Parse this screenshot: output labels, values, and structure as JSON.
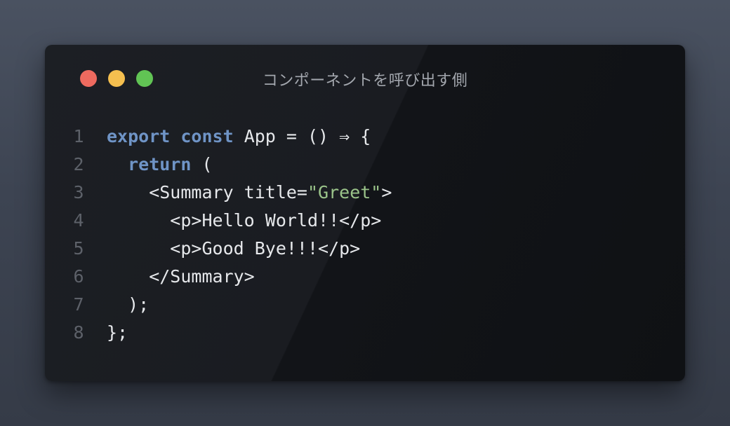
{
  "window": {
    "title": "コンポーネントを呼び出す側",
    "controls": {
      "close_color": "#ee6a5f",
      "minimize_color": "#f5bf4f",
      "maximize_color": "#61c454"
    }
  },
  "colors": {
    "keyword": "#6f94c6",
    "string": "#9bc48a",
    "text": "#e6e8eb",
    "line_number": "#5d6169"
  },
  "code": {
    "lines": [
      {
        "number": "1",
        "tokens": [
          {
            "t": "kw",
            "v": "export"
          },
          {
            "t": "plain",
            "v": " "
          },
          {
            "t": "kw",
            "v": "const"
          },
          {
            "t": "plain",
            "v": " App = () ⇒ {"
          }
        ]
      },
      {
        "number": "2",
        "tokens": [
          {
            "t": "plain",
            "v": "  "
          },
          {
            "t": "kw",
            "v": "return"
          },
          {
            "t": "plain",
            "v": " ("
          }
        ]
      },
      {
        "number": "3",
        "tokens": [
          {
            "t": "plain",
            "v": "    <Summary title="
          },
          {
            "t": "str",
            "v": "\"Greet\""
          },
          {
            "t": "plain",
            "v": ">"
          }
        ]
      },
      {
        "number": "4",
        "tokens": [
          {
            "t": "plain",
            "v": "      <p>Hello World!!</p>"
          }
        ]
      },
      {
        "number": "5",
        "tokens": [
          {
            "t": "plain",
            "v": "      <p>Good Bye!!!</p>"
          }
        ]
      },
      {
        "number": "6",
        "tokens": [
          {
            "t": "plain",
            "v": "    </Summary>"
          }
        ]
      },
      {
        "number": "7",
        "tokens": [
          {
            "t": "plain",
            "v": "  );"
          }
        ]
      },
      {
        "number": "8",
        "tokens": [
          {
            "t": "plain",
            "v": "};"
          }
        ]
      }
    ]
  }
}
